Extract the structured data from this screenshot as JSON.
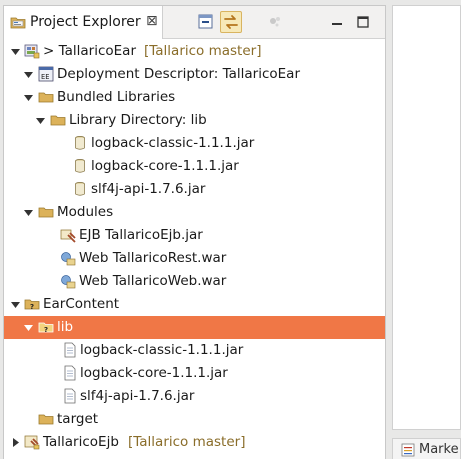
{
  "view": {
    "tab_title": "Project Explorer",
    "tab_close": "⊠"
  },
  "tree": [
    {
      "label": "> TallaricoEar",
      "decoration": "[Tallarico master]",
      "icon": "ear-project-icon",
      "expanded": true
    },
    {
      "label": "Deployment Descriptor: TallaricoEar",
      "decoration": "",
      "icon": "deployment-descriptor-icon",
      "expanded": true
    },
    {
      "label": "Bundled Libraries",
      "decoration": "",
      "icon": "folder-icon",
      "expanded": true
    },
    {
      "label": "Library Directory: lib",
      "decoration": "",
      "icon": "folder-icon",
      "expanded": true
    },
    {
      "label": "logback-classic-1.1.1.jar",
      "decoration": "",
      "icon": "jar-icon",
      "expanded": null
    },
    {
      "label": "logback-core-1.1.1.jar",
      "decoration": "",
      "icon": "jar-icon",
      "expanded": null
    },
    {
      "label": "slf4j-api-1.7.6.jar",
      "decoration": "",
      "icon": "jar-icon",
      "expanded": null
    },
    {
      "label": "Modules",
      "decoration": "",
      "icon": "folder-icon",
      "expanded": true
    },
    {
      "label": "EJB TallaricoEjb.jar",
      "decoration": "",
      "icon": "ejb-module-icon",
      "expanded": null
    },
    {
      "label": "Web TallaricoRest.war",
      "decoration": "",
      "icon": "web-module-icon",
      "expanded": null
    },
    {
      "label": "Web TallaricoWeb.war",
      "decoration": "",
      "icon": "web-module-icon",
      "expanded": null
    },
    {
      "label": "EarContent",
      "decoration": "",
      "icon": "folder-unknown-icon",
      "expanded": true
    },
    {
      "label": "lib",
      "decoration": "",
      "icon": "folder-unknown-icon",
      "expanded": true
    },
    {
      "label": "logback-classic-1.1.1.jar",
      "decoration": "",
      "icon": "file-icon",
      "expanded": null
    },
    {
      "label": "logback-core-1.1.1.jar",
      "decoration": "",
      "icon": "file-icon",
      "expanded": null
    },
    {
      "label": "slf4j-api-1.7.6.jar",
      "decoration": "",
      "icon": "file-icon",
      "expanded": null
    },
    {
      "label": "target",
      "decoration": "",
      "icon": "folder-icon",
      "expanded": null
    },
    {
      "label": "TallaricoEjb",
      "decoration": "[Tallarico master]",
      "icon": "ejb-project-icon",
      "expanded": false
    }
  ],
  "selected_label": "lib",
  "colors": {
    "selection": "#f07746",
    "decoration": "#8a6d2a",
    "folder": "#dcb25a"
  },
  "markers_tab": {
    "label": "Marke"
  }
}
